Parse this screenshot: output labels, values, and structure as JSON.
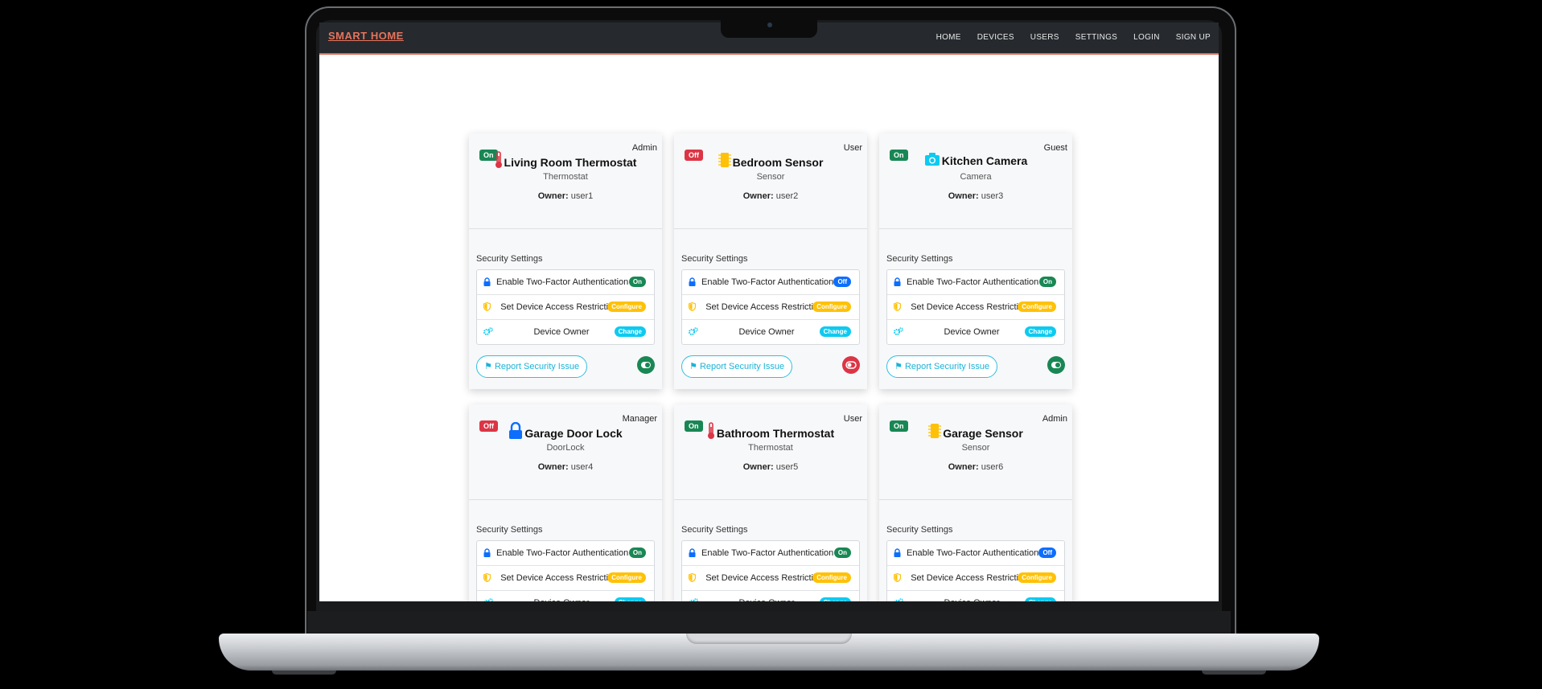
{
  "brand": "SMART HOME",
  "nav": [
    "HOME",
    "DEVICES",
    "USERS",
    "SETTINGS",
    "LOGIN",
    "SIGN UP"
  ],
  "section_label": "Security Settings",
  "owner_prefix": "Owner:",
  "report_label": "Report Security Issue",
  "setting_labels": [
    "Enable Two-Factor Authentication",
    "Set Device Access Restrictions",
    "Device Owner"
  ],
  "colors": {
    "on": "#198754",
    "off": "#dc3545",
    "blue": "#0d6efd",
    "warning": "#ffc107",
    "info": "#0dcaf0",
    "accent": "#e8735c"
  },
  "devices": [
    {
      "status": "On",
      "role": "Admin",
      "name": "Living Room Thermostat",
      "icon": "thermometer-icon",
      "icon_color": "#dc3545",
      "type": "Thermostat",
      "owner": "user1",
      "settings": [
        {
          "badge": "On",
          "color": "#198754"
        },
        {
          "badge": "Configure",
          "color": "#ffc107"
        },
        {
          "badge": "Change",
          "color": "#0dcaf0"
        }
      ],
      "toggle_on": true
    },
    {
      "status": "Off",
      "role": "User",
      "name": "Bedroom Sensor",
      "icon": "cpu-icon",
      "icon_color": "#ffc107",
      "type": "Sensor",
      "owner": "user2",
      "settings": [
        {
          "badge": "Off",
          "color": "#0d6efd"
        },
        {
          "badge": "Configure",
          "color": "#ffc107"
        },
        {
          "badge": "Change",
          "color": "#0dcaf0"
        }
      ],
      "toggle_on": false
    },
    {
      "status": "On",
      "role": "Guest",
      "name": "Kitchen Camera",
      "icon": "camera-icon",
      "icon_color": "#0dcaf0",
      "type": "Camera",
      "owner": "user3",
      "settings": [
        {
          "badge": "On",
          "color": "#198754"
        },
        {
          "badge": "Configure",
          "color": "#ffc107"
        },
        {
          "badge": "Change",
          "color": "#0dcaf0"
        }
      ],
      "toggle_on": true
    },
    {
      "status": "Off",
      "role": "Manager",
      "name": "Garage Door Lock",
      "icon": "lock-icon",
      "icon_color": "#0d6efd",
      "type": "DoorLock",
      "owner": "user4",
      "settings": [
        {
          "badge": "On",
          "color": "#198754"
        },
        {
          "badge": "Configure",
          "color": "#ffc107"
        },
        {
          "badge": "Change",
          "color": "#0dcaf0"
        }
      ],
      "toggle_on": false
    },
    {
      "status": "On",
      "role": "User",
      "name": "Bathroom Thermostat",
      "icon": "thermometer-icon",
      "icon_color": "#dc3545",
      "type": "Thermostat",
      "owner": "user5",
      "settings": [
        {
          "badge": "On",
          "color": "#198754"
        },
        {
          "badge": "Configure",
          "color": "#ffc107"
        },
        {
          "badge": "Change",
          "color": "#0dcaf0"
        }
      ],
      "toggle_on": true
    },
    {
      "status": "On",
      "role": "Admin",
      "name": "Garage Sensor",
      "icon": "cpu-icon",
      "icon_color": "#ffc107",
      "type": "Sensor",
      "owner": "user6",
      "settings": [
        {
          "badge": "Off",
          "color": "#0d6efd"
        },
        {
          "badge": "Configure",
          "color": "#ffc107"
        },
        {
          "badge": "Change",
          "color": "#0dcaf0"
        }
      ],
      "toggle_on": true
    }
  ]
}
